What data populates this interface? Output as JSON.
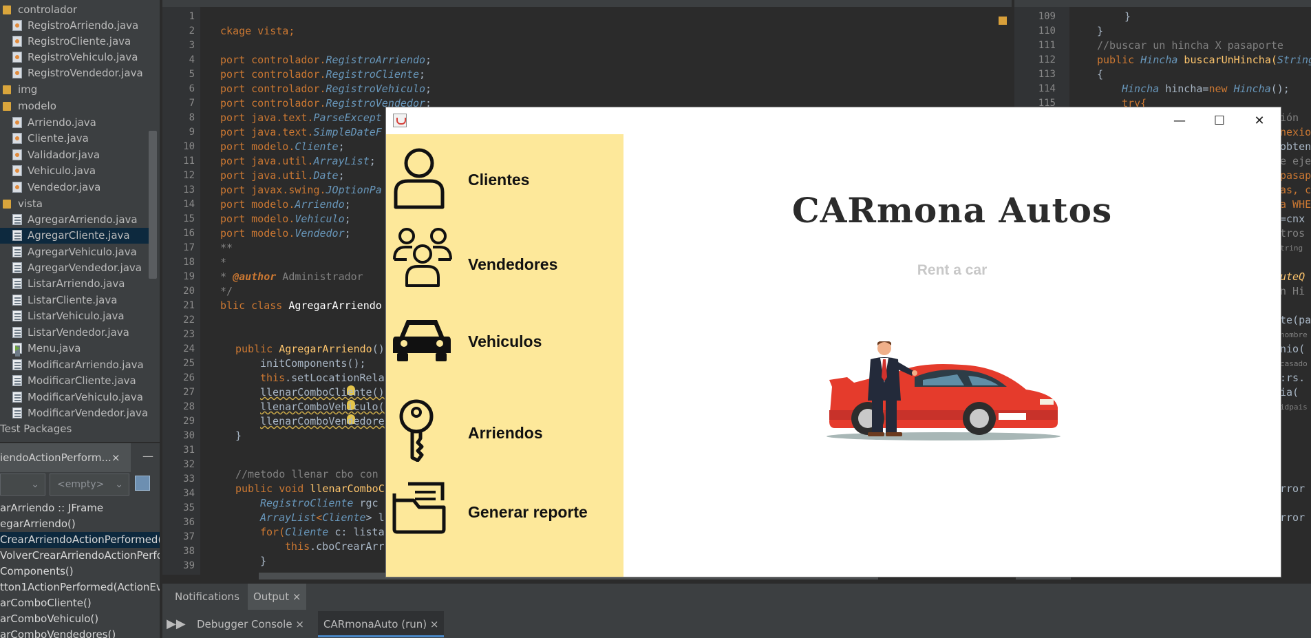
{
  "project_tree": {
    "items": [
      {
        "label": "controlador",
        "kind": "package"
      },
      {
        "label": "RegistroArriendo.java",
        "kind": "java"
      },
      {
        "label": "RegistroCliente.java",
        "kind": "java"
      },
      {
        "label": "RegistroVehiculo.java",
        "kind": "java"
      },
      {
        "label": "RegistroVendedor.java",
        "kind": "java"
      },
      {
        "label": "img",
        "kind": "package"
      },
      {
        "label": "modelo",
        "kind": "package"
      },
      {
        "label": "Arriendo.java",
        "kind": "java"
      },
      {
        "label": "Cliente.java",
        "kind": "java"
      },
      {
        "label": "Validador.java",
        "kind": "java"
      },
      {
        "label": "Vehiculo.java",
        "kind": "java"
      },
      {
        "label": "Vendedor.java",
        "kind": "java"
      },
      {
        "label": "vista",
        "kind": "package"
      },
      {
        "label": "AgregarArriendo.java",
        "kind": "form"
      },
      {
        "label": "AgregarCliente.java",
        "kind": "form",
        "selected": true
      },
      {
        "label": "AgregarVehiculo.java",
        "kind": "form"
      },
      {
        "label": "AgregarVendedor.java",
        "kind": "form"
      },
      {
        "label": "ListarArriendo.java",
        "kind": "form"
      },
      {
        "label": "ListarCliente.java",
        "kind": "form"
      },
      {
        "label": "ListarVehiculo.java",
        "kind": "form"
      },
      {
        "label": "ListarVendedor.java",
        "kind": "form"
      },
      {
        "label": "Menu.java",
        "kind": "main"
      },
      {
        "label": "ModificarArriendo.java",
        "kind": "form"
      },
      {
        "label": "ModificarCliente.java",
        "kind": "form"
      },
      {
        "label": "ModificarVehiculo.java",
        "kind": "form"
      },
      {
        "label": "ModificarVendedor.java",
        "kind": "form"
      },
      {
        "label": "Test Packages",
        "kind": "root"
      }
    ]
  },
  "navigator": {
    "tab_label": "iendoActionPerform...",
    "close": "×",
    "minimize": "—",
    "combo_left": "",
    "combo_right": "<empty>",
    "items": [
      "arArriendo :: JFrame",
      "egarArriendo()",
      "CrearArriendoActionPerformed(",
      "VolverCrearArriendoActionPerfo",
      "Components()",
      "tton1ActionPerformed(ActionEv",
      "arComboCliente()",
      "arComboVehiculo()",
      "arComboVendedores()"
    ]
  },
  "editor_left": {
    "line_numbers": [
      "1",
      "2",
      "3",
      "4",
      "5",
      "6",
      "7",
      "8",
      "9",
      "10",
      "11",
      "12",
      "13",
      "14",
      "15",
      "16",
      "17",
      "18",
      "19",
      "20",
      "21",
      "22",
      "23",
      "24",
      "25",
      "26",
      "27",
      "28",
      "29",
      "30",
      "31",
      "32",
      "33",
      "34",
      "35",
      "36",
      "37",
      "38",
      "39"
    ],
    "lines": {
      "l2": "ckage vista;",
      "l4a": "port controlador.",
      "l4b": "RegistroArriendo",
      "l4c": ";",
      "l5a": "port controlador.",
      "l5b": "RegistroCliente",
      "l5c": ";",
      "l6a": "port controlador.",
      "l6b": "RegistroVehiculo",
      "l6c": ";",
      "l7a": "port controlador.",
      "l7b": "RegistroVendedor",
      "l7c": ";",
      "l8a": "port java.text.",
      "l8b": "ParseExcept",
      "l9a": "port java.text.",
      "l9b": "SimpleDateF",
      "l10a": "port modelo.",
      "l10b": "Cliente",
      "l10c": ";",
      "l11a": "port java.util.",
      "l11b": "ArrayList",
      "l11c": ";",
      "l12a": "port java.util.",
      "l12b": "Date",
      "l12c": ";",
      "l13a": "port javax.swing.",
      "l13b": "JOptionPa",
      "l14a": "port modelo.",
      "l14b": "Arriendo",
      "l14c": ";",
      "l15a": "port modelo.",
      "l15b": "Vehiculo",
      "l15c": ";",
      "l16a": "port modelo.",
      "l16b": "Vendedor",
      "l16c": ";",
      "l17": "**",
      "l18": "*",
      "l19a": "* ",
      "l19b": "@author",
      "l19c": " Administrador",
      "l20": "*/",
      "l21a": "blic class ",
      "l21b": "AgregarArriendo",
      "l24a": "public ",
      "l24b": "AgregarArriendo",
      "l25": "initComponents();",
      "l26a": "this",
      "l26b": ".setLocationRela",
      "l27": "llenarComboCliente()",
      "l28": "llenarComboVehiculo(",
      "l29": "llenarComboVendedore",
      "l30": "}",
      "l33": "//metodo llenar cbo con",
      "l34a": "public void ",
      "l34b": "llenarComboC",
      "l35a": "RegistroCliente",
      "l35b": " rgc",
      "l36a": "ArrayList",
      "l36b": "<",
      "l36c": "Cliente",
      "l36d": "> l",
      "l37a": "for(",
      "l37b": "Cliente",
      "l37c": " c: lista",
      "l38a": "this",
      "l38b": ".cboCrearArr",
      "l39": "}"
    }
  },
  "editor_right": {
    "line_numbers": [
      "109",
      "110",
      "111",
      "112",
      "113",
      "114",
      "115"
    ],
    "lines": {
      "r109": "}",
      "r110": "}",
      "r111": "//buscar un hincha X pasaporte",
      "r112a": "public ",
      "r112b": "Hincha",
      "r112c": " buscarUnHincha(",
      "r112d": "String",
      "r113": "{",
      "r114a": "Hincha",
      "r114b": " hincha=",
      "r114c": "new ",
      "r114d": "Hincha",
      "r114e": "();",
      "r115": "try{"
    },
    "peek": [
      "ión",
      "nexion",
      "obtene",
      "e eje",
      "pasap",
      "as, c",
      "a WHE",
      "=cnx",
      "tros",
      "tring",
      "uteQ",
      "n Hi",
      "te(pa",
      "nombre",
      "nio(",
      "casado",
      ":rs.",
      "ia(",
      "idpais",
      "rror",
      "rror"
    ]
  },
  "bottom_panel": {
    "tabs": [
      "Notifications",
      "Output"
    ],
    "active_tab": "Output",
    "subtabs": [
      "Debugger Console",
      "CARmonaAuto (run)"
    ],
    "active_subtab": "CARmonaAuto (run)",
    "close": "×"
  },
  "app_window": {
    "title": "",
    "controls": {
      "minimize": "—",
      "maximize": "☐",
      "close": "✕"
    },
    "menu": [
      {
        "label": "Clientes",
        "icon": "user-icon"
      },
      {
        "label": "Vendedores",
        "icon": "group-icon"
      },
      {
        "label": "Vehiculos",
        "icon": "car-icon"
      },
      {
        "label": "Arriendos",
        "icon": "key-icon"
      },
      {
        "label": "Generar reporte",
        "icon": "folder-icon"
      }
    ],
    "brand": "CARmona Autos",
    "tagline": "Rent a car",
    "colors": {
      "sidebar": "#fde89a",
      "car": "#e53b2c",
      "brand_text": "#2b2b2b",
      "tagline": "#c8c8c8"
    }
  }
}
